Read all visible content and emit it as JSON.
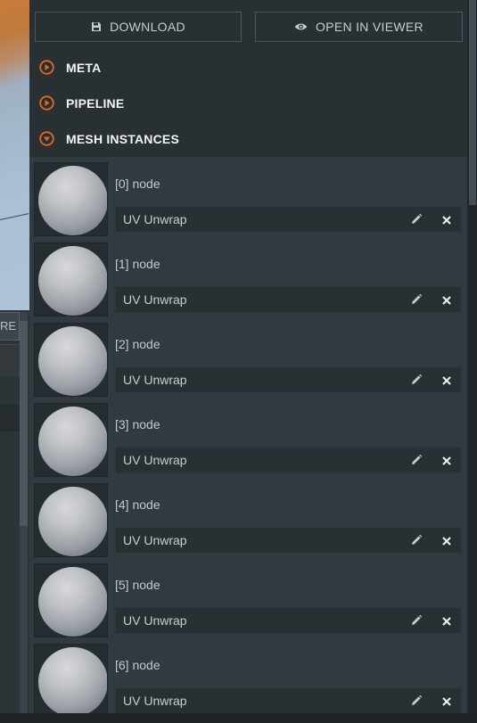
{
  "left_partial": {
    "button_fragment": "RE"
  },
  "toolbar": {
    "download_label": "DOWNLOAD",
    "viewer_label": "OPEN IN VIEWER"
  },
  "sections": [
    {
      "label": "META",
      "state": "collapsed"
    },
    {
      "label": "PIPELINE",
      "state": "collapsed"
    },
    {
      "label": "MESH INSTANCES",
      "state": "expanded"
    }
  ],
  "mesh_instances": [
    {
      "node": "[0] node",
      "modifier": "UV Unwrap"
    },
    {
      "node": "[1] node",
      "modifier": "UV Unwrap"
    },
    {
      "node": "[2] node",
      "modifier": "UV Unwrap"
    },
    {
      "node": "[3] node",
      "modifier": "UV Unwrap"
    },
    {
      "node": "[4] node",
      "modifier": "UV Unwrap"
    },
    {
      "node": "[5] node",
      "modifier": "UV Unwrap"
    },
    {
      "node": "[6] node",
      "modifier": "UV Unwrap"
    }
  ],
  "colors": {
    "accent": "#e36a1e",
    "panel_bg": "#303a3f",
    "header_bg": "#283034",
    "text": "#c6cdd1"
  },
  "icons": {
    "download": "save-icon",
    "viewer": "eye-icon",
    "collapsed": "play-circle-icon",
    "expanded": "chevron-down-circle-icon",
    "edit": "pencil-icon",
    "delete": "close-icon"
  }
}
